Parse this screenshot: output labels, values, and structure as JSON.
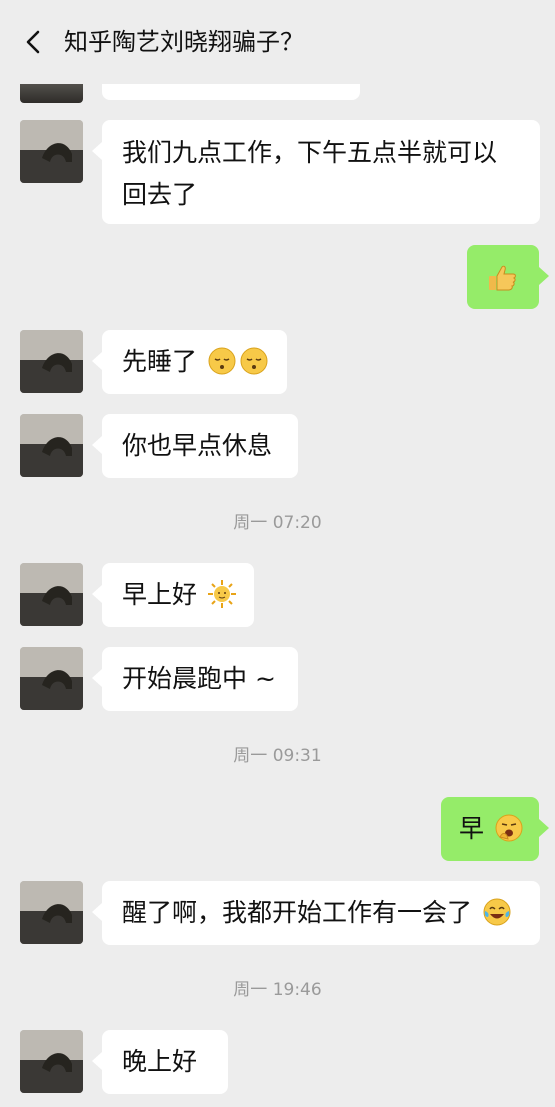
{
  "header": {
    "title": "知乎陶艺刘晓翔骗子？"
  },
  "messages": [
    {
      "text": "我们九点工作，下午五点半就可以回去了"
    },
    {
      "emoji": "thumbs-up-icon"
    },
    {
      "text": "先睡了"
    },
    {
      "text": "你也早点休息"
    },
    {
      "text": "早上好"
    },
    {
      "text": "开始晨跑中 ~"
    },
    {
      "text": "早"
    },
    {
      "text": "醒了啊，我都开始工作有一会了"
    },
    {
      "text": "晚上好"
    }
  ],
  "timestamps": [
    "周一 07:20",
    "周一 09:31",
    "周一 19:46"
  ]
}
